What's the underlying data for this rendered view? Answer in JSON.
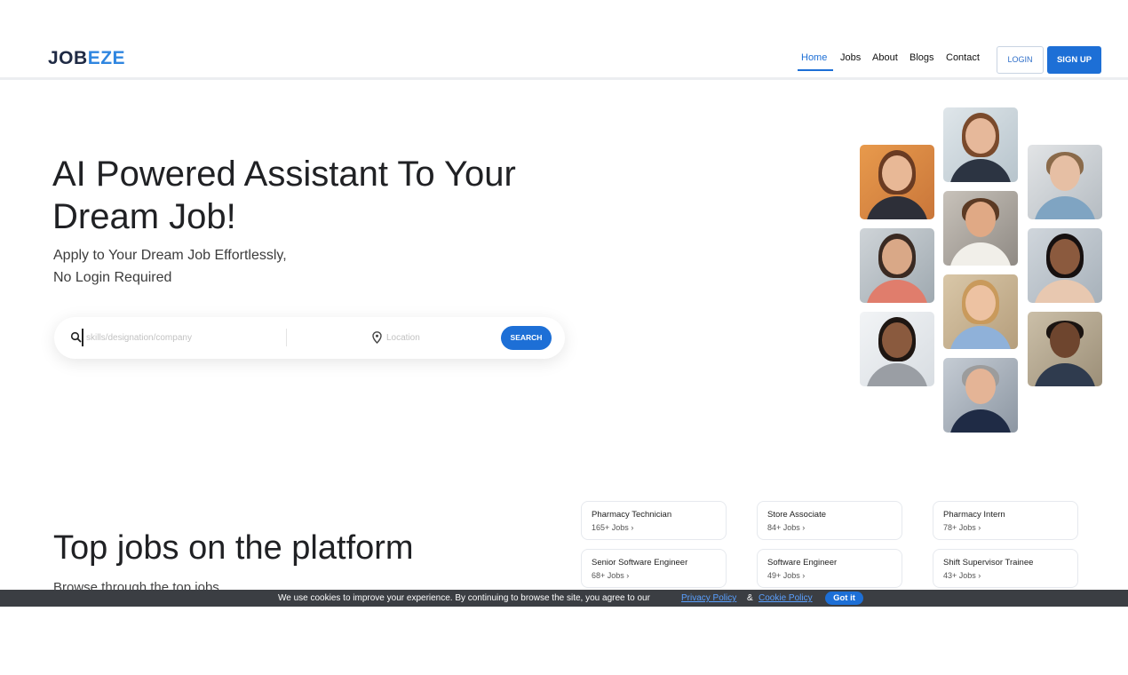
{
  "header": {
    "logo_part1": "JOB",
    "logo_part2": "EZE",
    "nav": [
      {
        "label": "Home",
        "active": true
      },
      {
        "label": "Jobs",
        "active": false
      },
      {
        "label": "About",
        "active": false
      },
      {
        "label": "Blogs",
        "active": false
      },
      {
        "label": "Contact",
        "active": false
      }
    ],
    "login_label": "LOGIN",
    "signup_label": "SIGN UP"
  },
  "hero": {
    "title_line1": "AI Powered Assistant To Your",
    "title_line2": "Dream Job!",
    "subtitle_line1": "Apply to Your Dream Job Effortlessly,",
    "subtitle_line2": "No Login Required",
    "search": {
      "keyword_placeholder": "skills/designation/company",
      "location_placeholder": "Location",
      "button_label": "SEARCH"
    }
  },
  "top_jobs": {
    "title": "Top jobs on the platform",
    "subtitle": "Browse through the top jobs",
    "cards": [
      {
        "name": "Pharmacy Technician",
        "count": "165+ Jobs"
      },
      {
        "name": "Store Associate",
        "count": "84+ Jobs"
      },
      {
        "name": "Pharmacy Intern",
        "count": "78+ Jobs"
      },
      {
        "name": "Senior Software Engineer",
        "count": "68+ Jobs"
      },
      {
        "name": "Software Engineer",
        "count": "49+ Jobs"
      },
      {
        "name": "Shift Supervisor Trainee",
        "count": "43+ Jobs"
      }
    ]
  },
  "cookie_bar": {
    "text": "We use cookies to improve your experience. By continuing to browse the site, you agree to our",
    "privacy_link": "Privacy Policy",
    "separator": "&",
    "cookie_link": "Cookie Policy",
    "button_label": "Got it"
  },
  "colors": {
    "brand_dark": "#1f2a44",
    "brand_blue": "#2f86e0",
    "accent": "#1d6fd6",
    "cookie_bar_bg": "#3b3e43"
  }
}
